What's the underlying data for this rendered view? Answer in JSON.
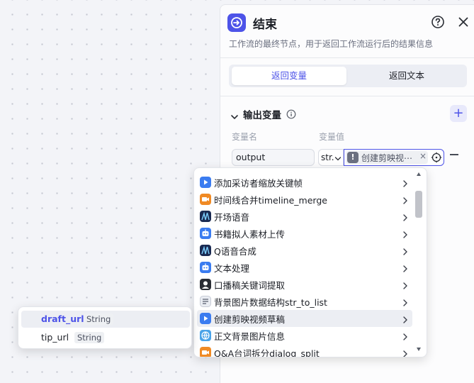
{
  "panel": {
    "title": "结束",
    "description": "工作流的最终节点，用于返回工作流运行后的结果信息",
    "tabs": [
      {
        "label": "返回变量",
        "active": true
      },
      {
        "label": "返回文本",
        "active": false
      }
    ],
    "section_title": "输出变量",
    "columns": {
      "name": "变量名",
      "value": "变量值"
    },
    "row": {
      "name_value": "output",
      "type_value": "str.",
      "reference_label": "创建剪映视⋯"
    }
  },
  "dropdown": {
    "items": [
      {
        "label": "添加采访者缩放关键帧",
        "icon": "video-icon",
        "color": "#3b7cf0",
        "selected": false
      },
      {
        "label": "时间线合并timeline_merge",
        "icon": "video-orange-icon",
        "color": "#f08a24",
        "selected": false
      },
      {
        "label": "开场语音",
        "icon": "audio-icon",
        "color": "#1a2a52",
        "selected": false
      },
      {
        "label": "书籍拟人素材上传",
        "icon": "robot-icon",
        "color": "#3b7cf0",
        "selected": false
      },
      {
        "label": "Q语音合成",
        "icon": "audio-icon",
        "color": "#1a2a52",
        "selected": false
      },
      {
        "label": "文本处理",
        "icon": "robot-icon",
        "color": "#3b7cf0",
        "selected": false
      },
      {
        "label": "口播稿关键词提取",
        "icon": "avatar-icon",
        "color": "#2a2d34",
        "selected": false
      },
      {
        "label": "背景图片数据结构str_to_list",
        "icon": "doc-icon",
        "color": "#e9ecf2",
        "selected": false
      },
      {
        "label": "创建剪映视频草稿",
        "icon": "video-icon",
        "color": "#3b7cf0",
        "selected": true
      },
      {
        "label": "正文背景图片信息",
        "icon": "globe-icon",
        "color": "#4aa3e8",
        "selected": false
      },
      {
        "label": "Q&A台词拆分dialog_split",
        "icon": "video-orange-icon",
        "color": "#f08a24",
        "selected": false
      }
    ]
  },
  "popover": {
    "items": [
      {
        "name": "draft_url",
        "type": "String",
        "selected": true
      },
      {
        "name": "tip_url",
        "type": "String",
        "selected": false
      }
    ]
  },
  "colors": {
    "accent": "#4d53e8",
    "canvas": "#f3f4f8",
    "selected_row": "#eceef3"
  }
}
